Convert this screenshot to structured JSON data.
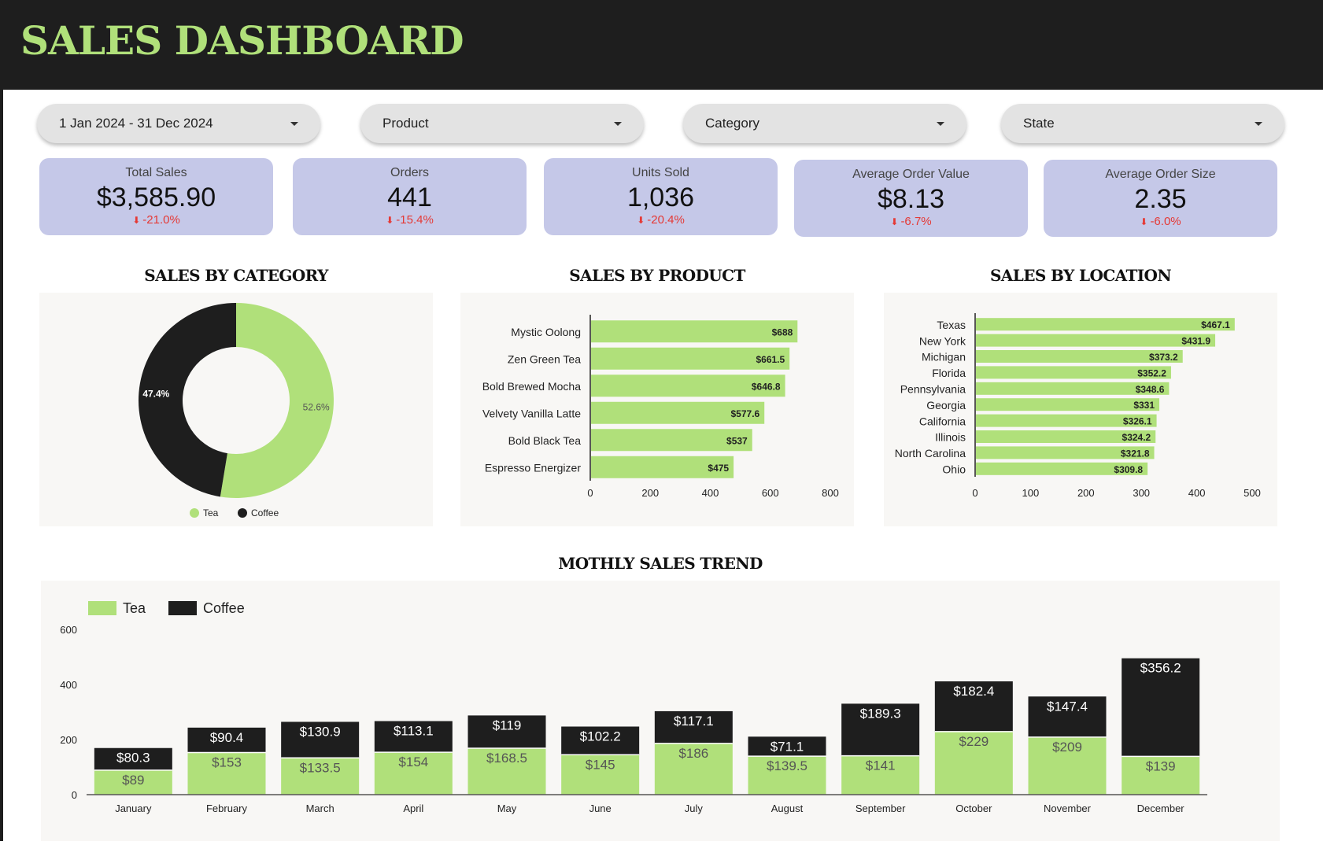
{
  "header": {
    "title": "SALES DASHBOARD"
  },
  "filters": [
    {
      "label": "1 Jan 2024 - 31 Dec 2024"
    },
    {
      "label": "Product"
    },
    {
      "label": "Category"
    },
    {
      "label": "State"
    }
  ],
  "kpis": [
    {
      "label": "Total Sales",
      "value": "$3,585.90",
      "delta": "-21.0%"
    },
    {
      "label": "Orders",
      "value": "441",
      "delta": "-15.4%"
    },
    {
      "label": "Units Sold",
      "value": "1,036",
      "delta": "-20.4%"
    },
    {
      "label": "Average Order Value",
      "value": "$8.13",
      "delta": "-6.7%"
    },
    {
      "label": "Average Order Size",
      "value": "2.35",
      "delta": "-6.0%"
    }
  ],
  "colors": {
    "tea": "#b0e07a",
    "coffee": "#1e1e1e",
    "negative": "#e53935",
    "kpi_bg": "#c5c8e8",
    "panel_bg": "#f8f7f5"
  },
  "sections": {
    "category": "SALES BY CATEGORY",
    "product": "SALES BY PRODUCT",
    "location": "SALES BY LOCATION",
    "trend": "MOTHLY SALES TREND"
  },
  "chart_data": [
    {
      "type": "pie",
      "donut": true,
      "slices": [
        {
          "name": "Tea",
          "value": 52.6,
          "label": "52.6%"
        },
        {
          "name": "Coffee",
          "value": 47.4,
          "label": "47.4%"
        }
      ],
      "legend": [
        "Tea",
        "Coffee"
      ],
      "legend_position": "bottom"
    },
    {
      "type": "bar",
      "orientation": "horizontal",
      "categories": [
        "Mystic Oolong",
        "Zen Green Tea",
        "Bold Brewed Mocha",
        "Velvety Vanilla Latte",
        "Bold Black Tea",
        "Espresso Energizer"
      ],
      "values": [
        688,
        661.5,
        646.8,
        577.6,
        537,
        475
      ],
      "labels": [
        "$688",
        "$661.5",
        "$646.8",
        "$577.6",
        "$537",
        "$475"
      ],
      "xlim": [
        0,
        800
      ],
      "ticks": [
        "0",
        "200",
        "400",
        "600",
        "800"
      ]
    },
    {
      "type": "bar",
      "orientation": "horizontal",
      "categories": [
        "Texas",
        "New York",
        "Michigan",
        "Florida",
        "Pennsylvania",
        "Georgia",
        "California",
        "Illinois",
        "North Carolina",
        "Ohio"
      ],
      "values": [
        467.1,
        431.9,
        373.2,
        352.2,
        348.6,
        331,
        326.1,
        324.2,
        321.8,
        309.8
      ],
      "labels": [
        "$467.1",
        "$431.9",
        "$373.2",
        "$352.2",
        "$348.6",
        "$331",
        "$326.1",
        "$324.2",
        "$321.8",
        "$309.8"
      ],
      "xlim": [
        0,
        500
      ],
      "ticks": [
        "0",
        "100",
        "200",
        "300",
        "400",
        "500"
      ]
    },
    {
      "type": "bar",
      "stacked": true,
      "categories": [
        "January",
        "February",
        "March",
        "April",
        "May",
        "June",
        "July",
        "August",
        "September",
        "October",
        "November",
        "December"
      ],
      "series": [
        {
          "name": "Tea",
          "values": [
            89,
            153,
            133.5,
            154,
            168.5,
            145,
            186,
            139.5,
            141,
            229,
            209,
            139
          ],
          "labels": [
            "$89",
            "$153",
            "$133.5",
            "$154",
            "$168.5",
            "$145",
            "$186",
            "$139.5",
            "$141",
            "$229",
            "$209",
            "$139"
          ]
        },
        {
          "name": "Coffee",
          "values": [
            80.3,
            90.4,
            130.9,
            113.1,
            119,
            102.2,
            117.1,
            71.1,
            189.3,
            182.4,
            147.4,
            356.2
          ],
          "labels": [
            "$80.3",
            "$90.4",
            "$130.9",
            "$113.1",
            "$119",
            "$102.2",
            "$117.1",
            "$71.1",
            "$189.3",
            "$182.4",
            "$147.4",
            "$356.2"
          ]
        }
      ],
      "ylim": [
        0,
        600
      ],
      "ticks": [
        "0",
        "200",
        "400",
        "600"
      ],
      "legend_position": "top-left"
    }
  ]
}
